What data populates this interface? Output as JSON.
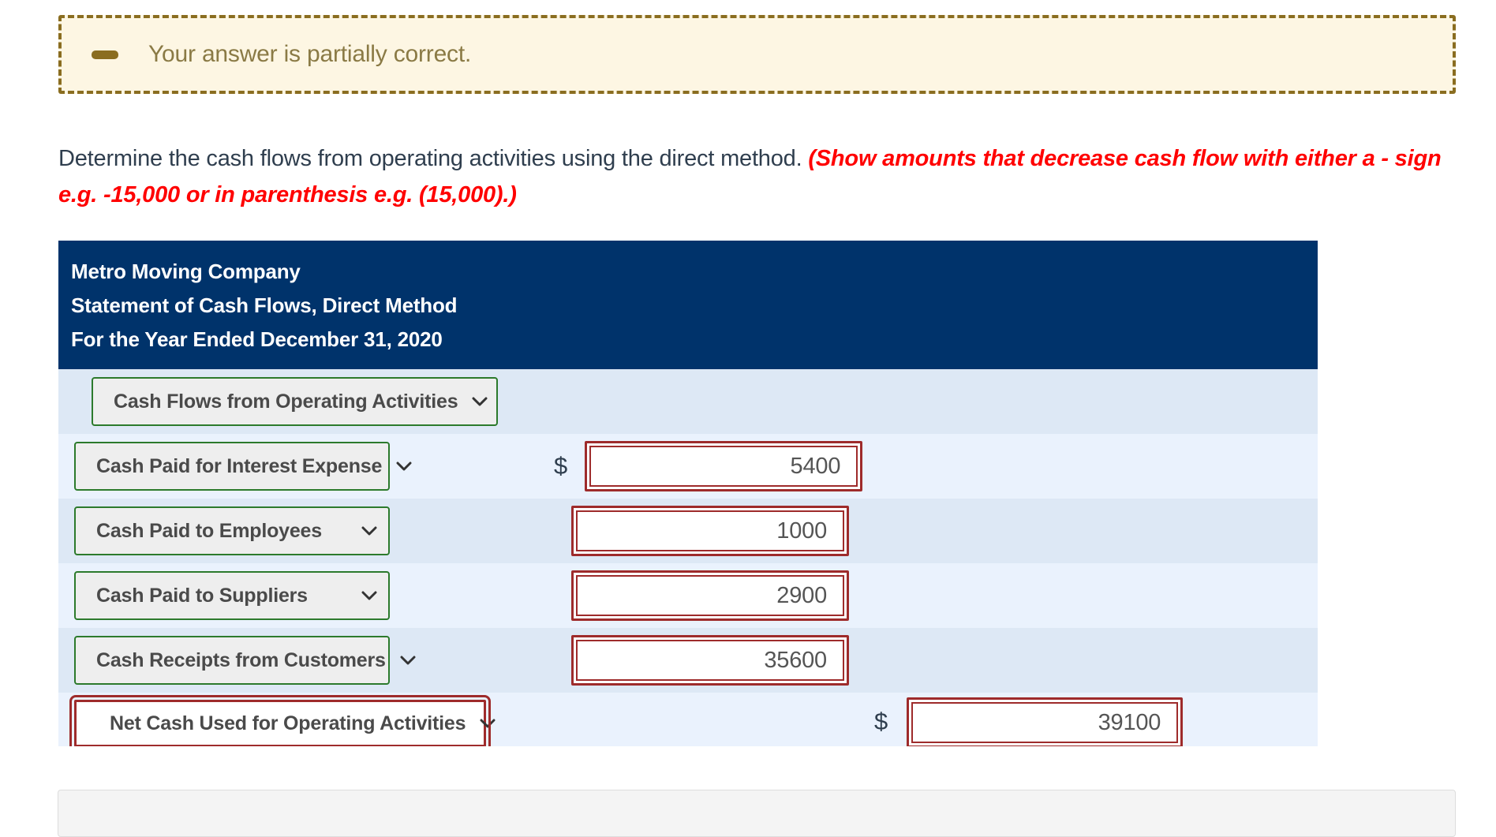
{
  "alert": {
    "icon": "dash-icon",
    "message": "Your answer is partially correct.",
    "bg_color": "#fdf6e3",
    "border_color": "#8a6d20",
    "text_color": "#8a7a45"
  },
  "instruction": {
    "main": "Determine the cash flows from operating activities using the direct method. ",
    "emphasis": "(Show amounts that decrease cash flow with either a - sign e.g. -15,000 or in parenthesis e.g. (15,000).)",
    "emphasis_color": "#ff0000"
  },
  "statement": {
    "header": {
      "company": "Metro Moving Company",
      "title": "Statement of Cash Flows, Direct Method",
      "period": "For the Year Ended December 31, 2020",
      "bg_color": "#00336b"
    },
    "rows": [
      {
        "label": "Cash Flows from Operating Activities",
        "select_border": "#2c7a2c",
        "currency": "",
        "value": ""
      },
      {
        "label": "Cash Paid for Interest Expense",
        "select_border": "#2c7a2c",
        "currency": "$",
        "value": "5400"
      },
      {
        "label": "Cash Paid to Employees",
        "select_border": "#2c7a2c",
        "currency": "",
        "value": "1000"
      },
      {
        "label": "Cash Paid to Suppliers",
        "select_border": "#2c7a2c",
        "currency": "",
        "value": "2900"
      },
      {
        "label": "Cash Receipts from Customers",
        "select_border": "#2c7a2c",
        "currency": "",
        "value": "35600"
      },
      {
        "label": "Net Cash Used for Operating Activities",
        "select_border": "#9e2b2b",
        "currency": "$",
        "value": "39100"
      }
    ],
    "input_border_color": "#9e2b2b"
  }
}
